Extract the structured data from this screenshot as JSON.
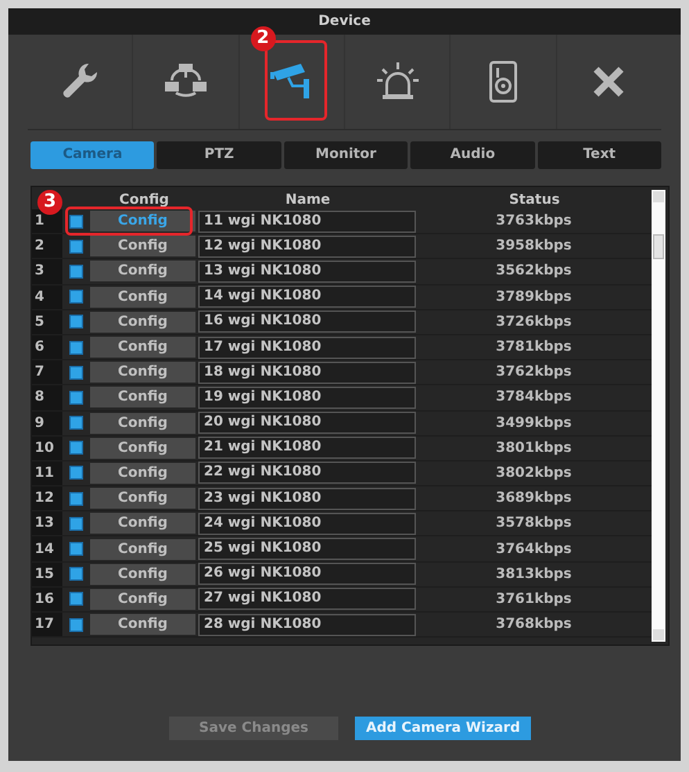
{
  "window": {
    "title": "Device"
  },
  "toolbar": {
    "items": [
      {
        "kind": "wrench",
        "selected": false
      },
      {
        "kind": "network",
        "selected": false
      },
      {
        "kind": "camera",
        "selected": true,
        "callout": "2"
      },
      {
        "kind": "alarm",
        "selected": false
      },
      {
        "kind": "disk",
        "selected": false
      },
      {
        "kind": "close",
        "selected": false
      }
    ]
  },
  "tabs": [
    {
      "label": "Camera",
      "selected": true
    },
    {
      "label": "PTZ",
      "selected": false
    },
    {
      "label": "Monitor",
      "selected": false
    },
    {
      "label": "Audio",
      "selected": false
    },
    {
      "label": "Text",
      "selected": false
    }
  ],
  "table": {
    "columns": [
      "Config",
      "Name",
      "Status"
    ],
    "rows": [
      {
        "number": "1",
        "checked": true,
        "config": "Config",
        "focused": true,
        "name": "11 wgi NK1080",
        "status": "3763kbps",
        "callout": "3"
      },
      {
        "number": "2",
        "checked": true,
        "config": "Config",
        "focused": false,
        "name": "12 wgi NK1080",
        "status": "3958kbps"
      },
      {
        "number": "3",
        "checked": true,
        "config": "Config",
        "focused": false,
        "name": "13 wgi NK1080",
        "status": "3562kbps"
      },
      {
        "number": "4",
        "checked": true,
        "config": "Config",
        "focused": false,
        "name": "14 wgi NK1080",
        "status": "3789kbps"
      },
      {
        "number": "5",
        "checked": true,
        "config": "Config",
        "focused": false,
        "name": "16 wgi NK1080",
        "status": "3726kbps"
      },
      {
        "number": "6",
        "checked": true,
        "config": "Config",
        "focused": false,
        "name": "17 wgi NK1080",
        "status": "3781kbps"
      },
      {
        "number": "7",
        "checked": true,
        "config": "Config",
        "focused": false,
        "name": "18 wgi NK1080",
        "status": "3762kbps"
      },
      {
        "number": "8",
        "checked": true,
        "config": "Config",
        "focused": false,
        "name": "19 wgi NK1080",
        "status": "3784kbps"
      },
      {
        "number": "9",
        "checked": true,
        "config": "Config",
        "focused": false,
        "name": "20 wgi NK1080",
        "status": "3499kbps"
      },
      {
        "number": "10",
        "checked": true,
        "config": "Config",
        "focused": false,
        "name": "21 wgi NK1080",
        "status": "3801kbps"
      },
      {
        "number": "11",
        "checked": true,
        "config": "Config",
        "focused": false,
        "name": "22 wgi NK1080",
        "status": "3802kbps"
      },
      {
        "number": "12",
        "checked": true,
        "config": "Config",
        "focused": false,
        "name": "23 wgi NK1080",
        "status": "3689kbps"
      },
      {
        "number": "13",
        "checked": true,
        "config": "Config",
        "focused": false,
        "name": "24 wgi NK1080",
        "status": "3578kbps"
      },
      {
        "number": "14",
        "checked": true,
        "config": "Config",
        "focused": false,
        "name": "25 wgi NK1080",
        "status": "3764kbps"
      },
      {
        "number": "15",
        "checked": true,
        "config": "Config",
        "focused": false,
        "name": "26 wgi NK1080",
        "status": "3813kbps"
      },
      {
        "number": "16",
        "checked": true,
        "config": "Config",
        "focused": false,
        "name": "27 wgi NK1080",
        "status": "3761kbps"
      },
      {
        "number": "17",
        "checked": true,
        "config": "Config",
        "focused": false,
        "name": "28 wgi NK1080",
        "status": "3768kbps"
      }
    ]
  },
  "buttons": [
    {
      "label": "Save Changes",
      "disabled": true
    },
    {
      "label": "Add Camera Wizard",
      "disabled": false
    }
  ]
}
